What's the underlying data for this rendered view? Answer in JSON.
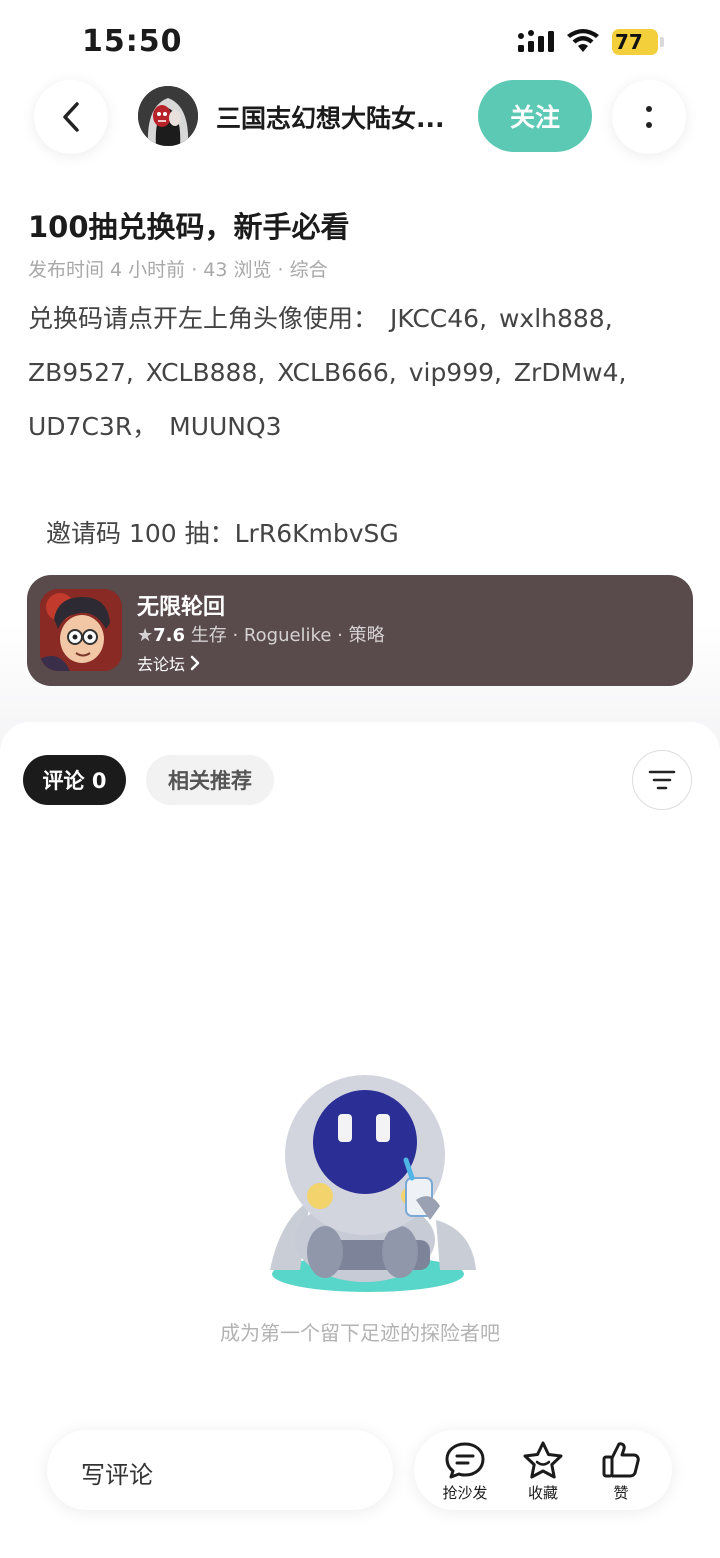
{
  "status_bar": {
    "time": "15:50",
    "battery": "77"
  },
  "header": {
    "author_name": "三国志幻想大陆女...",
    "follow_label": "关注"
  },
  "post": {
    "title": "100抽兑换码，新手必看",
    "meta": "发布时间 4 小时前 · 43 浏览 · 综合",
    "body": "兑换码请点开左上角头像使用： JKCC46, wxlh888, ZB9527, XCLB888, XCLB666, vip999, ZrDMw4, UD7C3R， MUUNQ3",
    "invite": "邀请码 100 抽：LrR6KmbvSG"
  },
  "game_card": {
    "name": "无限轮回",
    "rating": "7.6",
    "tags": "生存 · Roguelike · 策略",
    "link_label": "去论坛"
  },
  "comments": {
    "tab_comments": "评论 0",
    "tab_related": "相关推荐",
    "empty_text": "成为第一个留下足迹的探险者吧"
  },
  "bottom_bar": {
    "input_placeholder": "写评论",
    "actions": [
      {
        "label": "抢沙发",
        "icon": "comment-bubble-icon"
      },
      {
        "label": "收藏",
        "icon": "star-icon"
      },
      {
        "label": "赞",
        "icon": "thumbs-up-icon"
      }
    ]
  },
  "colors": {
    "accent": "#5cc9b5",
    "card_bg": "#594a4c",
    "battery": "#f2cf3b"
  }
}
